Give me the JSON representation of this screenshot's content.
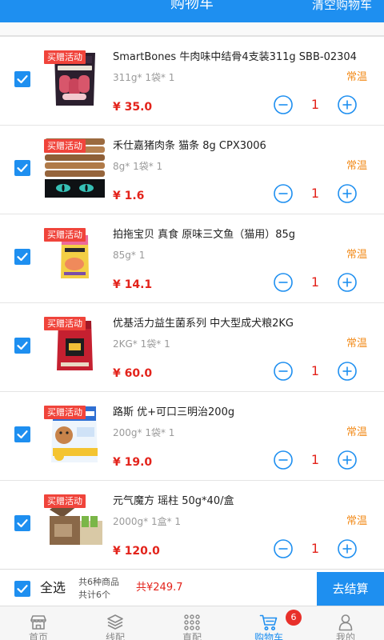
{
  "header": {
    "title": "购物车",
    "clear_label": "清空购物车"
  },
  "items": [
    {
      "badge": "买赠活动",
      "title": "SmartBones 牛肉味中结骨4支装311g SBB-02304",
      "spec": "311g* 1袋* 1",
      "storage": "常温",
      "price": "¥ 35.0",
      "quantity": "1",
      "checked": true
    },
    {
      "badge": "买赠活动",
      "title": "禾仕嘉猪肉条 猫条 8g CPX3006",
      "spec": "8g* 1袋* 1",
      "storage": "常温",
      "price": "¥ 1.6",
      "quantity": "1",
      "checked": true
    },
    {
      "badge": "买赠活动",
      "title": "拍拖宝贝 真食 原味三文鱼（猫用）85g",
      "spec": "85g* 1",
      "storage": "常温",
      "price": "¥ 14.1",
      "quantity": "1",
      "checked": true
    },
    {
      "badge": "买赠活动",
      "title": "优基活力益生菌系列 中大型成犬粮2KG",
      "spec": "2KG* 1袋* 1",
      "storage": "常温",
      "price": "¥ 60.0",
      "quantity": "1",
      "checked": true
    },
    {
      "badge": "买赠活动",
      "title": "路斯 优+可口三明治200g",
      "spec": "200g* 1袋* 1",
      "storage": "常温",
      "price": "¥ 19.0",
      "quantity": "1",
      "checked": true
    },
    {
      "badge": "买赠活动",
      "title": "元气魔方 瑶柱 50g*40/盒",
      "spec": "2000g* 1盒* 1",
      "storage": "常温",
      "price": "¥ 120.0",
      "quantity": "1",
      "checked": true
    }
  ],
  "footer": {
    "select_all_label": "全选",
    "select_all_checked": true,
    "kinds_text": "共6种商品",
    "count_text": "共计6个",
    "total_text": "共¥249.7",
    "checkout_label": "去结算"
  },
  "tabbar": {
    "tabs": [
      {
        "label": "首页",
        "icon": "store-icon",
        "active": false
      },
      {
        "label": "线配",
        "icon": "layers-icon",
        "active": false
      },
      {
        "label": "直配",
        "icon": "grid-icon",
        "active": false
      },
      {
        "label": "购物车",
        "icon": "cart-icon",
        "active": true
      },
      {
        "label": "我的",
        "icon": "user-icon",
        "active": false
      }
    ],
    "cart_badge": "6"
  },
  "colors": {
    "blue": "#1e8ff0",
    "price_red": "#e3231b",
    "storage_orange": "#f28c1c",
    "badge_red": "#f0443b",
    "tab_gray": "#8a8a8a"
  }
}
